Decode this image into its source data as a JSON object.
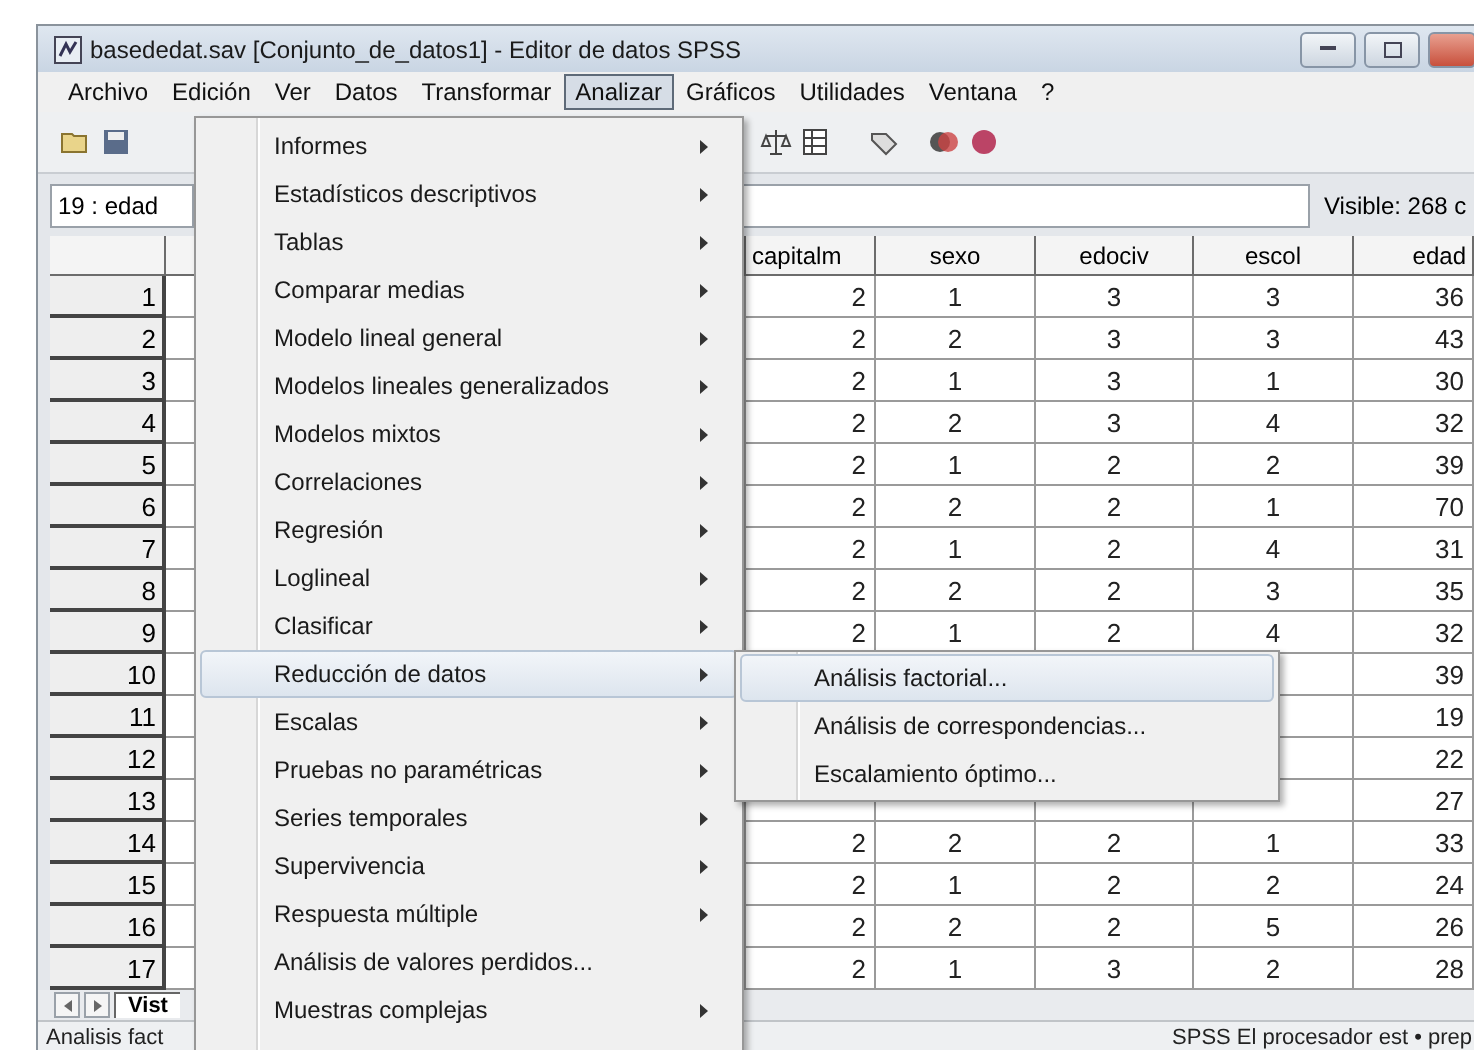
{
  "window": {
    "title": "basededat.sav [Conjunto_de_datos1] - Editor de datos SPSS"
  },
  "menu_bar": [
    {
      "label": "Archivo",
      "selected": false
    },
    {
      "label": "Edición",
      "selected": false
    },
    {
      "label": "Ver",
      "selected": false
    },
    {
      "label": "Datos",
      "selected": false
    },
    {
      "label": "Transformar",
      "selected": false
    },
    {
      "label": "Analizar",
      "selected": true
    },
    {
      "label": "Gráficos",
      "selected": false
    },
    {
      "label": "Utilidades",
      "selected": false
    },
    {
      "label": "Ventana",
      "selected": false
    },
    {
      "label": "?",
      "selected": false
    }
  ],
  "cell_editor": {
    "cell_name": "19 : edad",
    "visible_count": "Visible: 268 c"
  },
  "table": {
    "columns": [
      "capitalm",
      "sexo",
      "edociv",
      "escol",
      "edad"
    ],
    "rows": [
      {
        "number": "1",
        "cells": [
          "2",
          "1",
          "3",
          "3",
          "36"
        ]
      },
      {
        "number": "2",
        "cells": [
          "2",
          "2",
          "3",
          "3",
          "43"
        ]
      },
      {
        "number": "3",
        "cells": [
          "2",
          "1",
          "3",
          "1",
          "30"
        ]
      },
      {
        "number": "4",
        "cells": [
          "2",
          "2",
          "3",
          "4",
          "32"
        ]
      },
      {
        "number": "5",
        "cells": [
          "2",
          "1",
          "2",
          "2",
          "39"
        ]
      },
      {
        "number": "6",
        "cells": [
          "2",
          "2",
          "2",
          "1",
          "70"
        ]
      },
      {
        "number": "7",
        "cells": [
          "2",
          "1",
          "2",
          "4",
          "31"
        ]
      },
      {
        "number": "8",
        "cells": [
          "2",
          "2",
          "2",
          "3",
          "35"
        ]
      },
      {
        "number": "9",
        "cells": [
          "2",
          "1",
          "2",
          "4",
          "32"
        ]
      },
      {
        "number": "10",
        "cells": [
          null,
          null,
          null,
          null,
          "39"
        ]
      },
      {
        "number": "11",
        "cells": [
          null,
          null,
          null,
          null,
          "19"
        ]
      },
      {
        "number": "12",
        "cells": [
          null,
          null,
          null,
          null,
          "22"
        ]
      },
      {
        "number": "13",
        "cells": [
          null,
          null,
          null,
          null,
          "27"
        ]
      },
      {
        "number": "14",
        "cells": [
          "2",
          "2",
          "2",
          "1",
          "33"
        ]
      },
      {
        "number": "15",
        "cells": [
          "2",
          "1",
          "2",
          "2",
          "24"
        ]
      },
      {
        "number": "16",
        "cells": [
          "2",
          "2",
          "2",
          "5",
          "26"
        ]
      },
      {
        "number": "17",
        "cells": [
          "2",
          "1",
          "3",
          "2",
          "28"
        ]
      }
    ]
  },
  "sheet_tabs": [
    {
      "label": "Vist",
      "selected": true
    }
  ],
  "status_bar": {
    "left": "Analisis fact",
    "right": "SPSS El procesador  est • prep"
  },
  "analyze_menu": {
    "items": [
      {
        "label": "Informes",
        "submenu": true,
        "selected": false
      },
      {
        "label": "Estadísticos descriptivos",
        "submenu": true,
        "selected": false
      },
      {
        "label": "Tablas",
        "submenu": true,
        "selected": false
      },
      {
        "label": "Comparar medias",
        "submenu": true,
        "selected": false
      },
      {
        "label": "Modelo lineal general",
        "submenu": true,
        "selected": false
      },
      {
        "label": "Modelos lineales generalizados",
        "submenu": true,
        "selected": false
      },
      {
        "label": "Modelos mixtos",
        "submenu": true,
        "selected": false
      },
      {
        "label": "Correlaciones",
        "submenu": true,
        "selected": false
      },
      {
        "label": "Regresión",
        "submenu": true,
        "selected": false
      },
      {
        "label": "Loglineal",
        "submenu": true,
        "selected": false
      },
      {
        "label": "Clasificar",
        "submenu": true,
        "selected": false
      },
      {
        "label": "Reducción de datos",
        "submenu": true,
        "selected": true
      },
      {
        "label": "Escalas",
        "submenu": true,
        "selected": false
      },
      {
        "label": "Pruebas no paramétricas",
        "submenu": true,
        "selected": false
      },
      {
        "label": "Series temporales",
        "submenu": true,
        "selected": false
      },
      {
        "label": "Supervivencia",
        "submenu": true,
        "selected": false
      },
      {
        "label": "Respuesta múltiple",
        "submenu": true,
        "selected": false
      },
      {
        "label": "Análisis de valores perdidos...",
        "submenu": false,
        "selected": false
      },
      {
        "label": "Muestras complejas",
        "submenu": true,
        "selected": false
      }
    ]
  },
  "data_reduction_submenu": {
    "items": [
      {
        "label": "Análisis factorial...",
        "selected": true
      },
      {
        "label": "Análisis de correspondencias...",
        "selected": false
      },
      {
        "label": "Escalamiento óptimo...",
        "selected": false
      }
    ]
  }
}
